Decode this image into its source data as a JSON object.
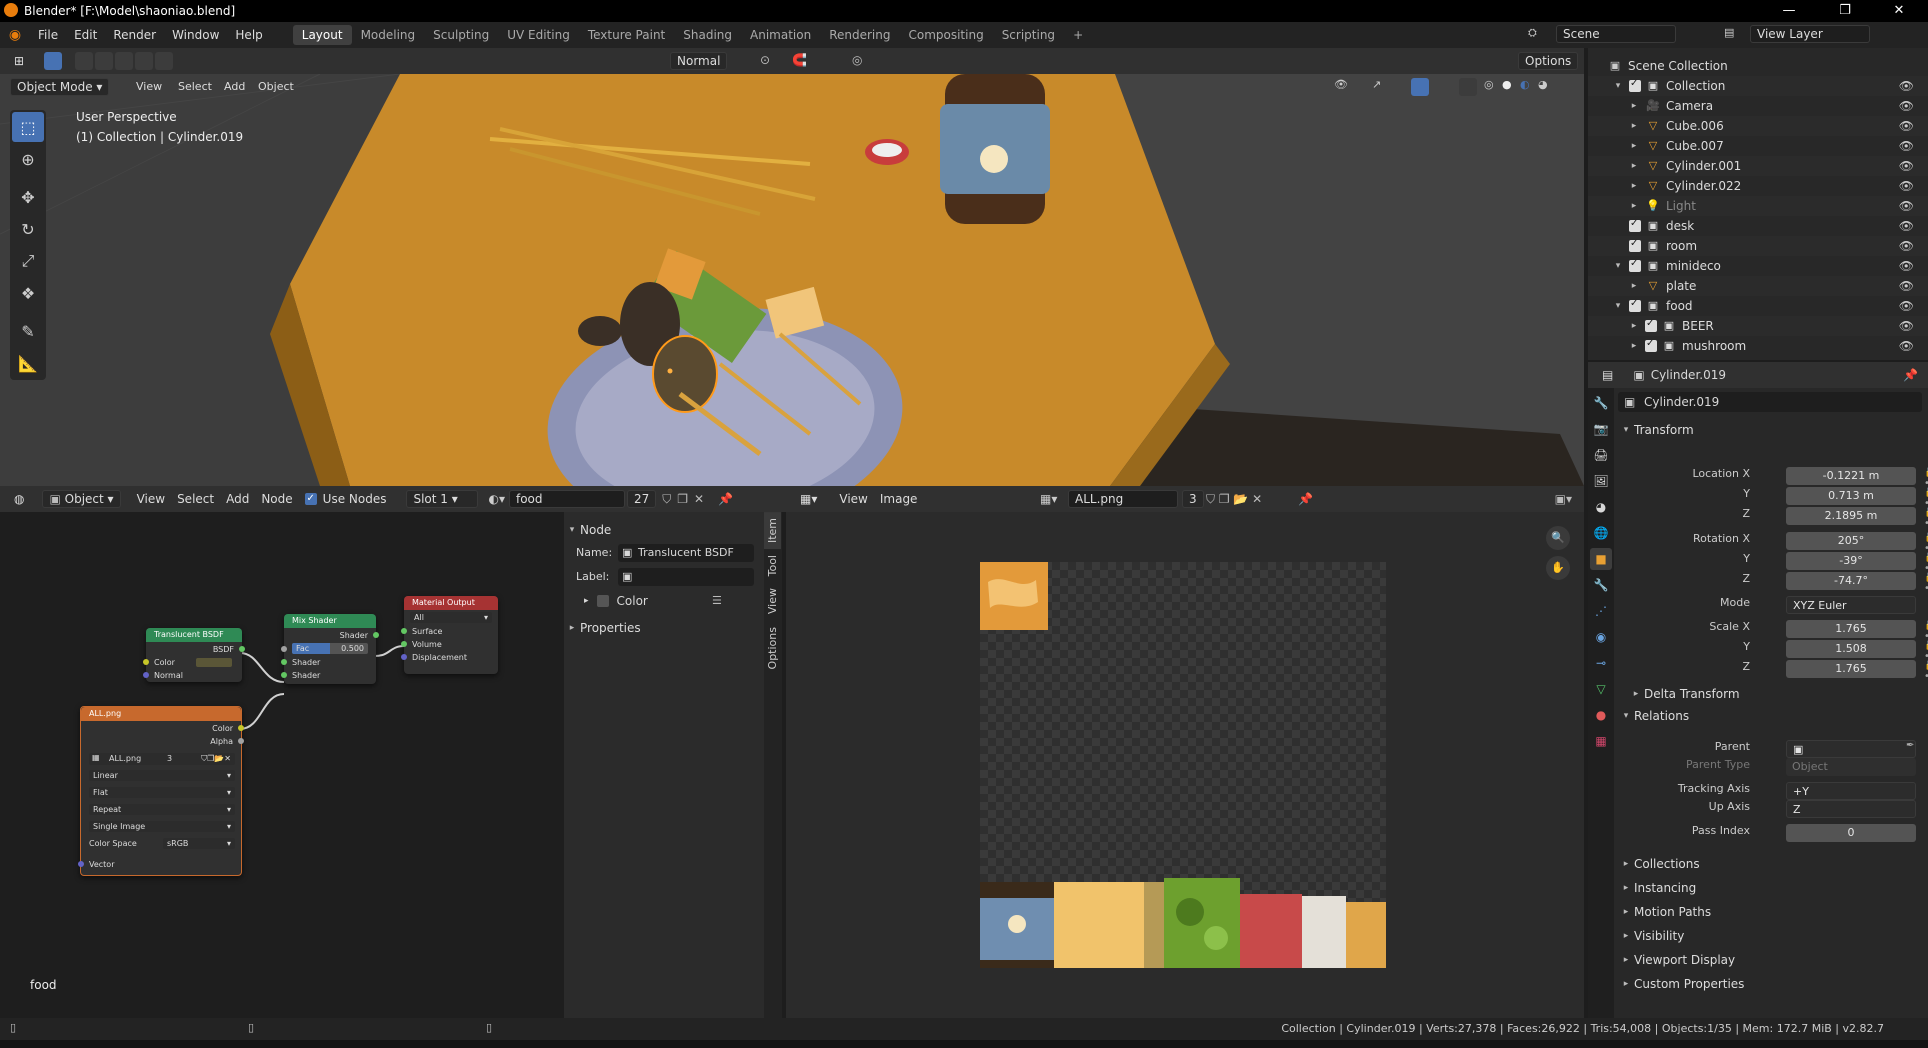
{
  "window": {
    "title": "Blender* [F:\\Model\\shaoniao.blend]",
    "minimize": "—",
    "maximize": "❐",
    "close": "✕"
  },
  "menubar": {
    "menus": [
      "File",
      "Edit",
      "Render",
      "Window",
      "Help"
    ],
    "workspaces": [
      "Layout",
      "Modeling",
      "Sculpting",
      "UV Editing",
      "Texture Paint",
      "Shading",
      "Animation",
      "Rendering",
      "Compositing",
      "Scripting"
    ],
    "active_workspace": "Layout",
    "add_tab": "+",
    "scene": "Scene",
    "view_layer": "View Layer"
  },
  "viewport_header": {
    "orientation": "Normal",
    "options": "Options",
    "mode": "Object Mode",
    "menus": [
      "View",
      "Select",
      "Add",
      "Object"
    ]
  },
  "viewport": {
    "perspective": "User Perspective",
    "context": "(1) Collection | Cylinder.019"
  },
  "outliner": {
    "rows": [
      {
        "label": "Scene Collection",
        "indent": 0,
        "icon": "scene-collection-icon",
        "arrow": "",
        "check": false
      },
      {
        "label": "Collection",
        "indent": 1,
        "icon": "collection-icon",
        "arrow": "▾",
        "check": true
      },
      {
        "label": "Camera",
        "indent": 2,
        "icon": "camera-icon",
        "arrow": "▸",
        "check": false
      },
      {
        "label": "Cube.006",
        "indent": 2,
        "icon": "mesh-icon",
        "arrow": "▸",
        "check": false
      },
      {
        "label": "Cube.007",
        "indent": 2,
        "icon": "mesh-icon",
        "arrow": "▸",
        "check": false
      },
      {
        "label": "Cylinder.001",
        "indent": 2,
        "icon": "mesh-icon",
        "arrow": "▸",
        "check": false
      },
      {
        "label": "Cylinder.022",
        "indent": 2,
        "icon": "mesh-icon",
        "arrow": "▸",
        "check": false
      },
      {
        "label": "Light",
        "indent": 2,
        "icon": "light-icon",
        "arrow": "▸",
        "check": false,
        "dim": true
      },
      {
        "label": "desk",
        "indent": 1,
        "icon": "collection-icon",
        "arrow": "",
        "check": true
      },
      {
        "label": "room",
        "indent": 1,
        "icon": "collection-icon",
        "arrow": "",
        "check": true
      },
      {
        "label": "minideco",
        "indent": 1,
        "icon": "collection-icon",
        "arrow": "▾",
        "check": true
      },
      {
        "label": "plate",
        "indent": 2,
        "icon": "mesh-icon",
        "arrow": "▸",
        "check": false
      },
      {
        "label": "food",
        "indent": 1,
        "icon": "collection-icon",
        "arrow": "▾",
        "check": true
      },
      {
        "label": "BEER",
        "indent": 2,
        "icon": "collection-icon",
        "arrow": "▸",
        "check": true
      },
      {
        "label": "mushroom",
        "indent": 2,
        "icon": "collection-icon",
        "arrow": "▸",
        "check": true
      }
    ]
  },
  "properties": {
    "object_name": "Cylinder.019",
    "datablock_name": "Cylinder.019",
    "transform": {
      "title": "Transform",
      "location_label": "Location X",
      "location": [
        "-0.1221 m",
        "0.713 m",
        "2.1895 m"
      ],
      "rotation_label": "Rotation X",
      "rotation": [
        "205°",
        "-39°",
        "-74.7°"
      ],
      "mode_label": "Mode",
      "mode": "XYZ Euler",
      "scale_label": "Scale X",
      "scale": [
        "1.765",
        "1.508",
        "1.765"
      ],
      "y_label": "Y",
      "z_label": "Z",
      "delta": "Delta Transform"
    },
    "relations": {
      "title": "Relations",
      "parent_label": "Parent",
      "parent_type_label": "Parent Type",
      "parent_type": "Object",
      "tracking_label": "Tracking Axis",
      "tracking": "+Y",
      "up_label": "Up Axis",
      "up": "Z",
      "pass_label": "Pass Index",
      "pass": "0"
    },
    "collapsed_sections": [
      "Collections",
      "Instancing",
      "Motion Paths",
      "Visibility",
      "Viewport Display",
      "Custom Properties"
    ]
  },
  "node_header": {
    "type": "Object",
    "menus": [
      "View",
      "Select",
      "Add",
      "Node"
    ],
    "use_nodes": "Use Nodes",
    "slot": "Slot 1",
    "material": "food",
    "users": "27"
  },
  "nodes": {
    "translucent": {
      "title": "Translucent BSDF",
      "out": "BSDF",
      "color": "Color",
      "normal": "Normal"
    },
    "mix": {
      "title": "Mix Shader",
      "out": "Shader",
      "fac": "Fac",
      "fac_value": "0.500",
      "s1": "Shader",
      "s2": "Shader"
    },
    "output": {
      "title": "Material Output",
      "target": "All",
      "surface": "Surface",
      "volume": "Volume",
      "displacement": "Displacement"
    },
    "image": {
      "title": "ALL.png",
      "color": "Color",
      "alpha": "Alpha",
      "image": "ALL.png",
      "users": "3",
      "interp": "Linear",
      "proj": "Flat",
      "ext": "Repeat",
      "src": "Single Image",
      "cs_label": "Color Space",
      "cs": "sRGB",
      "vector": "Vector"
    },
    "material_label": "food"
  },
  "npanel": {
    "section": "Node",
    "name_label": "Name:",
    "name": "Translucent BSDF",
    "label_label": "Label:",
    "label": "",
    "color": "Color",
    "properties": "Properties",
    "tabs": [
      "Item",
      "Tool",
      "View",
      "Options"
    ]
  },
  "image_header": {
    "menus": [
      "View",
      "Image"
    ],
    "image": "ALL.png",
    "users": "3"
  },
  "status": {
    "text": "Collection | Cylinder.019 | Verts:27,378 | Faces:26,922 | Tris:54,008 | Objects:1/35 | Mem: 172.7 MiB | v2.82.7"
  },
  "colors": {
    "accent": "#4772b3",
    "shader_node": "#2f8a55",
    "output_node": "#a63333",
    "texture_node": "#c7692d",
    "desk_wood": "#c88a2a"
  }
}
